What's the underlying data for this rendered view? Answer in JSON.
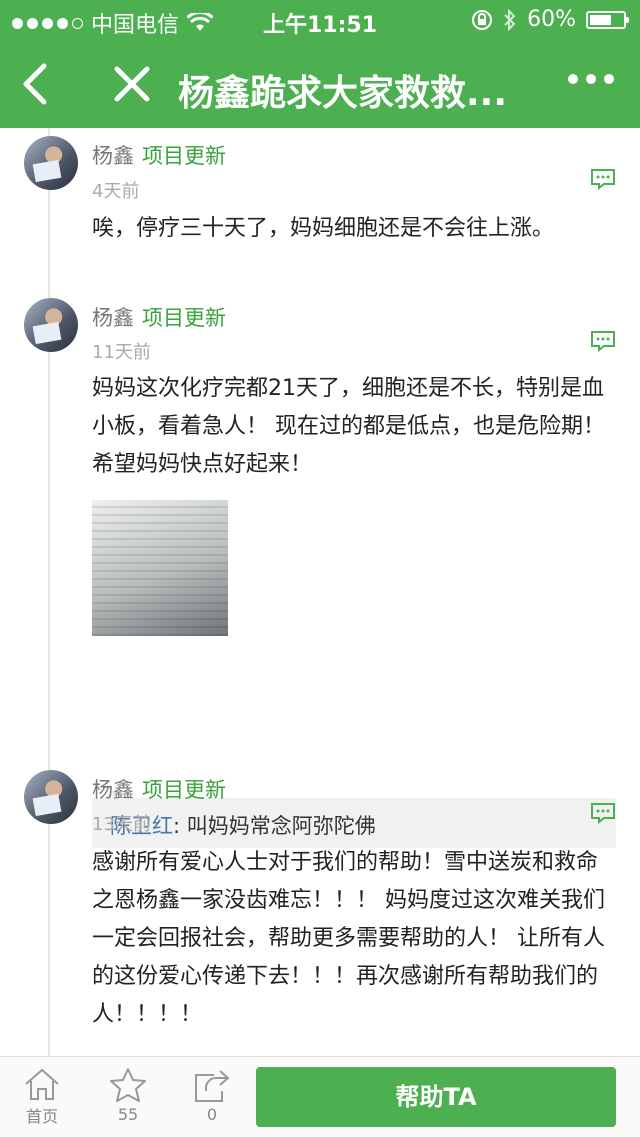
{
  "status_bar": {
    "carrier": "中国电信",
    "time": "上午11:51",
    "battery": "60%",
    "battery_level": 0.6
  },
  "nav": {
    "title": "杨鑫跪求大家救救...",
    "back_icon": "chevron-left-icon",
    "close_icon": "close-icon",
    "more_icon": "more-icon"
  },
  "posts": [
    {
      "name": "杨鑫",
      "tag": "项目更新",
      "time": "4天前",
      "text": "唉，停疗三十天了，妈妈细胞还是不会往上涨。"
    },
    {
      "name": "杨鑫",
      "tag": "项目更新",
      "time": "11天前",
      "text": "妈妈这次化疗完都21天了，细胞还是不长，特别是血小板，看着急人！ 现在过的都是低点，也是危险期！ 希望妈妈快点好起来！",
      "reply": {
        "name": "陈卫红",
        "separator": ": ",
        "text": "叫妈妈常念阿弥陀佛"
      }
    },
    {
      "name": "杨鑫",
      "tag": "项目更新",
      "time": "13天前",
      "text": "感谢所有爱心人士对于我们的帮助！雪中送炭和救命之恩杨鑫一家没齿难忘！！！ 妈妈度过这次难关我们一定会回报社会，帮助更多需要帮助的人！ 让所有人的这份爱心传递下去！！！再次感谢所有帮助我们的人！！！！"
    }
  ],
  "footer": {
    "home_label": "首页",
    "star_count": "55",
    "share_count": "0",
    "help_button": "帮助TA"
  },
  "colors": {
    "brand_green": "#4caf50",
    "tag_green": "#3aa23a",
    "reply_name_blue": "#4a78a8"
  }
}
